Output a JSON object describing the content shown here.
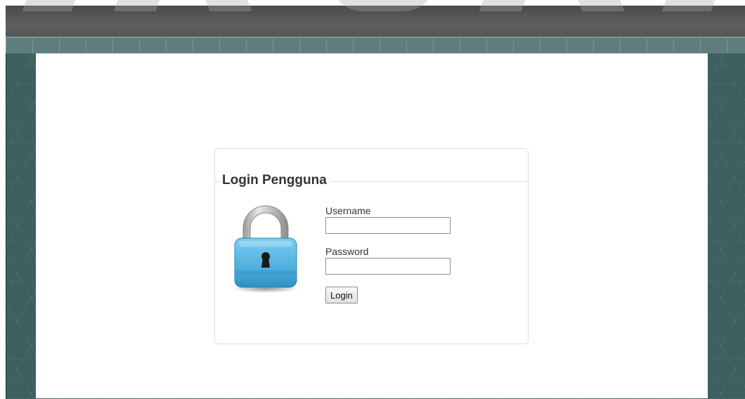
{
  "login": {
    "title": "Login Pengguna",
    "username_label": "Username",
    "username_value": "",
    "password_label": "Password",
    "password_value": "",
    "submit_label": "Login",
    "lock_icon": "padlock-icon"
  },
  "colors": {
    "frame": "#3d5f5f",
    "banner": "#565656",
    "stripe": "#5e7e7e",
    "lock_body": "#4fb0df",
    "border": "#dcdcdc"
  }
}
